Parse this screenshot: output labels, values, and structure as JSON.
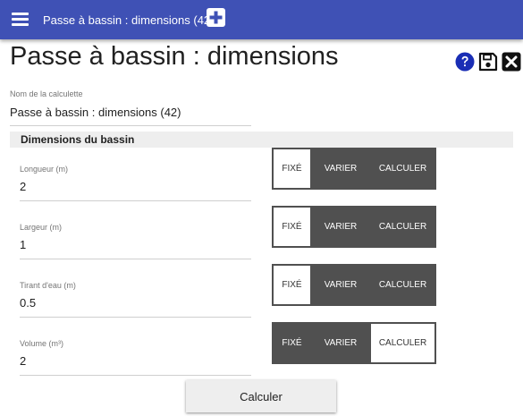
{
  "topbar": {
    "tab_title": "Passe à bassin : dimensions (42)"
  },
  "page": {
    "title": "Passe à bassin : dimensions"
  },
  "actions": {
    "help_icon": "question-circle-icon",
    "save_icon": "floppy-disk-icon",
    "close_icon": "close-square-icon"
  },
  "calc_name": {
    "label": "Nom de la calculette",
    "value": "Passe à bassin : dimensions (42)"
  },
  "section": {
    "title": "Dimensions du bassin"
  },
  "params": [
    {
      "label": "Longueur (m)",
      "value": "2",
      "mode": "fixe"
    },
    {
      "label": "Largeur (m)",
      "value": "1",
      "mode": "fixe"
    },
    {
      "label": "Tirant d'eau (m)",
      "value": "0.5",
      "mode": "fixe"
    },
    {
      "label": "Volume (m³)",
      "value": "2",
      "mode": "calculer"
    }
  ],
  "modes": {
    "fixe": "FIXÉ",
    "varier": "VARIER",
    "calculer": "CALCULER"
  },
  "calculate_button": "Calculer",
  "colors": {
    "topbar": "#3f51b5",
    "toggle_dark": "#505050",
    "section_bg": "#eeeeee"
  }
}
